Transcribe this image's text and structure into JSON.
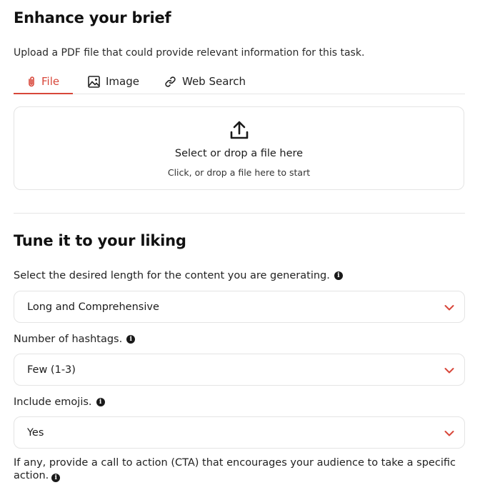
{
  "enhance": {
    "title": "Enhance your brief",
    "description": "Upload a PDF file that could provide relevant information for this task.",
    "tabs": [
      {
        "label": "File",
        "icon": "paperclip-icon",
        "active": true
      },
      {
        "label": "Image",
        "icon": "image-icon",
        "active": false
      },
      {
        "label": "Web Search",
        "icon": "link-icon",
        "active": false
      }
    ],
    "dropzone": {
      "icon": "upload-icon",
      "title": "Select or drop a file here",
      "subtitle": "Click, or drop a file here to start"
    }
  },
  "tune": {
    "title": "Tune it to your liking",
    "length": {
      "label": "Select the desired length for the content you are generating.",
      "value": "Long and Comprehensive"
    },
    "hashtags": {
      "label": "Number of hashtags.",
      "value": "Few (1-3)"
    },
    "emojis": {
      "label": "Include emojis.",
      "value": "Yes"
    },
    "cta": {
      "label": "If any, provide a call to action (CTA) that encourages your audience to take a specific action."
    }
  },
  "colors": {
    "accent": "#d8473a",
    "border": "#e4e4e4",
    "text": "#1c1c1c"
  }
}
